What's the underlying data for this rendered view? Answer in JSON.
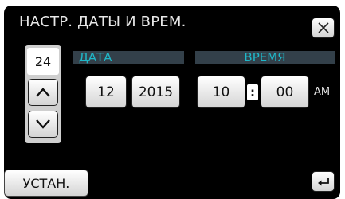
{
  "header": {
    "title": "НАСТР. ДАТЫ И ВРЕМ."
  },
  "icons": {
    "close": "close-icon",
    "up": "arrow-up-icon",
    "down": "arrow-down-icon",
    "back": "back-return-icon"
  },
  "date": {
    "label": "ДАТА",
    "day": "24",
    "month": "12",
    "year": "2015"
  },
  "time": {
    "label": "ВРЕМЯ",
    "hour": "10",
    "separator": ":",
    "minute": "00",
    "ampm": "AM"
  },
  "footer": {
    "set_label": "УСТАН."
  },
  "colors": {
    "label_text": "#1fb8c9",
    "label_bar": "#33404a",
    "background": "#000000"
  }
}
